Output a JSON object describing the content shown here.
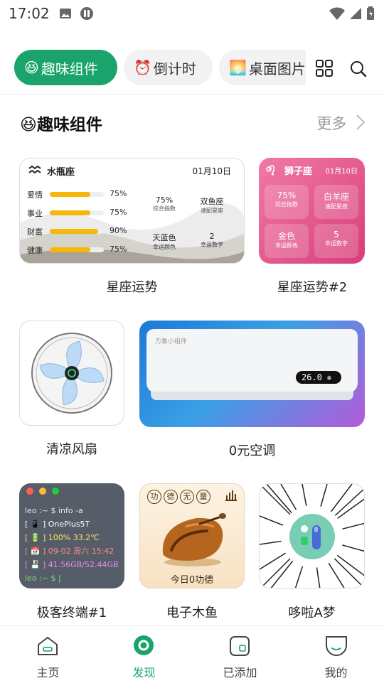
{
  "status_bar": {
    "time": "17:02"
  },
  "tabs": [
    {
      "emoji": "😆",
      "label": "趣味组件"
    },
    {
      "emoji": "⏰",
      "label": "倒计时"
    },
    {
      "emoji": "🌅",
      "label": "桌面图片"
    }
  ],
  "section": {
    "emoji": "😆",
    "title": "趣味组件",
    "more": "更多"
  },
  "aquarius": {
    "sign": "水瓶座",
    "date": "01月10日",
    "rows": [
      {
        "label": "爱情",
        "value": "75%",
        "pct": 75
      },
      {
        "label": "事业",
        "value": "75%",
        "pct": 75
      },
      {
        "label": "财富",
        "value": "90%",
        "pct": 90
      },
      {
        "label": "健康",
        "value": "75%",
        "pct": 75
      }
    ],
    "stats": [
      {
        "value": "75%",
        "caption": "综合指数"
      },
      {
        "value": "双鱼座",
        "caption": "速配星座"
      },
      {
        "value": "天蓝色",
        "caption": "幸运颜色"
      },
      {
        "value": "2",
        "caption": "幸运数字"
      }
    ]
  },
  "leo": {
    "sign": "狮子座",
    "date": "01月10日",
    "stats": [
      {
        "value": "75%",
        "caption": "综合指数"
      },
      {
        "value": "白羊座",
        "caption": "速配星座"
      },
      {
        "value": "金色",
        "caption": "幸运颜色"
      },
      {
        "value": "5",
        "caption": "幸运数字"
      }
    ]
  },
  "ac": {
    "brand": "万象小组件",
    "temp": "26.0"
  },
  "terminal": {
    "lines": [
      {
        "text": "leo :~ $ info -a",
        "color": "#e8e8e8"
      },
      {
        "text": "[ 📱 ] OnePlus5T",
        "color": "#ffffff"
      },
      {
        "text": "[ 🔋 ] 100% 33.2℃",
        "color": "#f5e663"
      },
      {
        "text": "[ 📅 ] 09-02 周六 15:42",
        "color": "#ff8a8a"
      },
      {
        "text": "[ 💾 ] 41.56GB/52.44GB",
        "color": "#e48cf5"
      },
      {
        "text": "leo :~ $ |",
        "color": "#7ae07a"
      }
    ]
  },
  "muyu": {
    "chars": [
      "功",
      "德",
      "无",
      "量"
    ],
    "caption": "今日0功德"
  },
  "labels": {
    "aquarius": "星座运势",
    "leo": "星座运势#2",
    "fan": "清凉风扇",
    "ac": "0元空调",
    "terminal": "极客终端#1",
    "muyu": "电子木鱼",
    "doraemon": "哆啦A梦"
  },
  "nav": [
    {
      "label": "主页"
    },
    {
      "label": "发现"
    },
    {
      "label": "已添加"
    },
    {
      "label": "我的"
    }
  ],
  "colors": {
    "accent": "#1aa36a",
    "bar": "#f5b70a"
  }
}
